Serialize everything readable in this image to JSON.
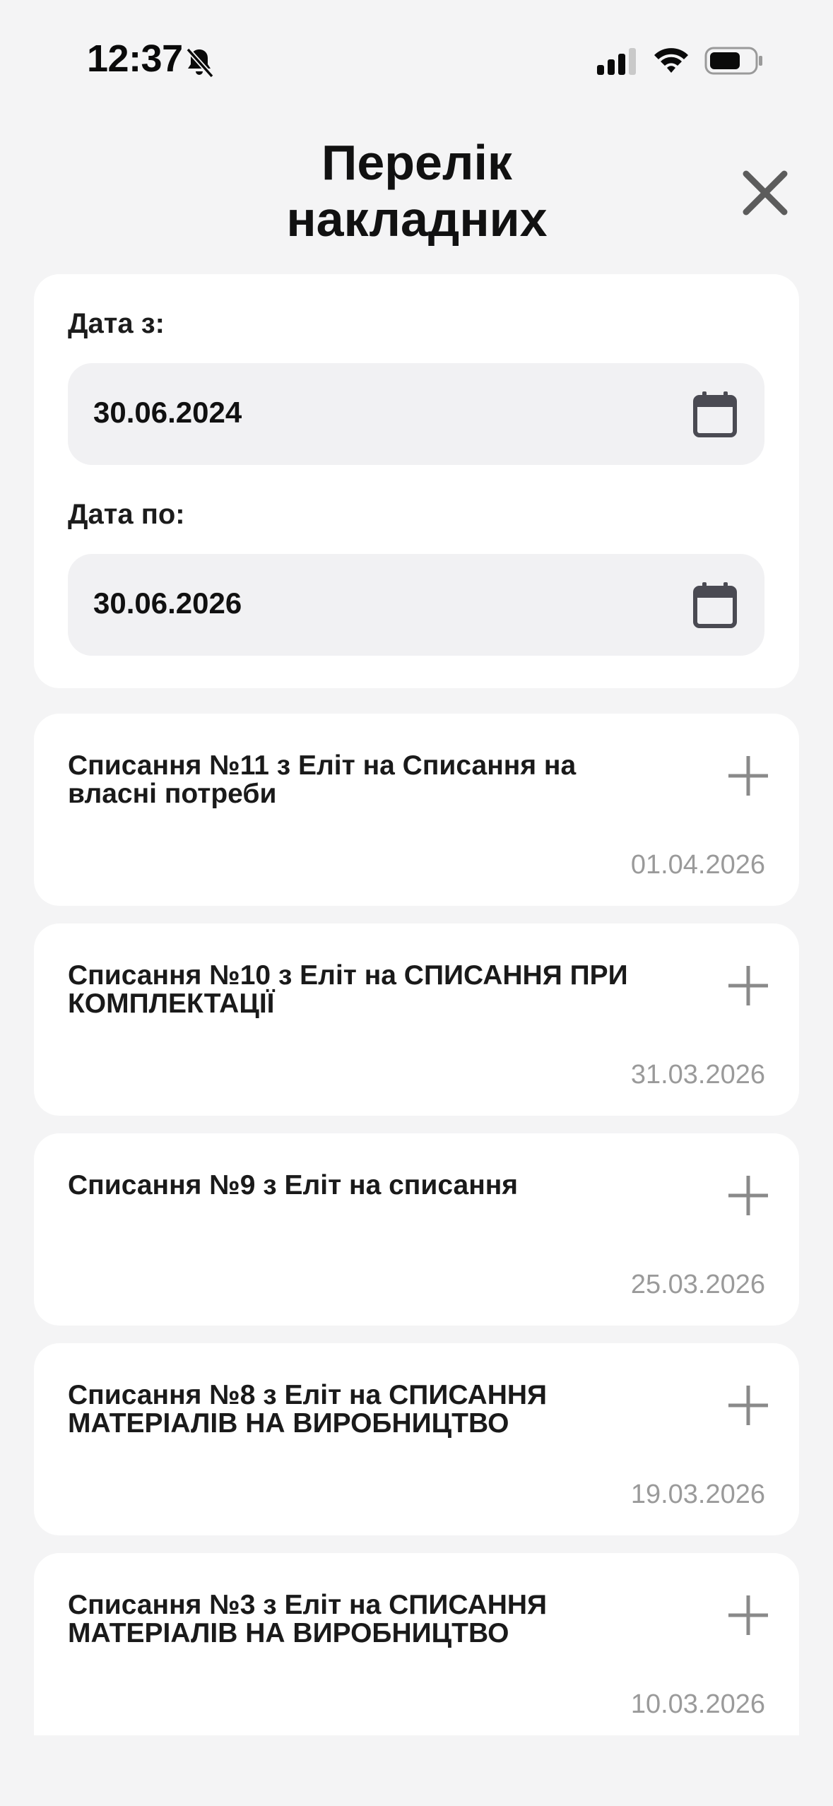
{
  "status_bar": {
    "time": "12:37",
    "icons": [
      "bell-slash-icon",
      "cellular-signal-icon",
      "wifi-icon",
      "battery-icon"
    ]
  },
  "header": {
    "title": "Перелік\nнакладних",
    "close_icon": "close-icon"
  },
  "filters": {
    "date_from": {
      "label": "Дата з:",
      "value": "30.06.2024",
      "icon": "calendar-icon"
    },
    "date_to": {
      "label": "Дата по:",
      "value": "30.06.2026",
      "icon": "calendar-icon"
    }
  },
  "invoices": [
    {
      "title": "Списання №11 з Еліт на Списання на власні потреби",
      "date": "01.04.2026"
    },
    {
      "title": "Списання №10 з Еліт на СПИСАННЯ ПРИ КОМПЛЕКТАЦІЇ",
      "date": "31.03.2026"
    },
    {
      "title": "Списання №9 з Еліт на списання",
      "date": "25.03.2026"
    },
    {
      "title": "Списання №8 з Еліт на СПИСАННЯ МАТЕРІАЛІВ НА ВИРОБНИЦТВО",
      "date": "19.03.2026"
    },
    {
      "title": "Списання №3 з Еліт на СПИСАННЯ МАТЕРІАЛІВ НА ВИРОБНИЦТВО",
      "date": "10.03.2026"
    }
  ],
  "colors": {
    "background": "#f4f4f5",
    "card": "#ffffff",
    "input_bg": "#f1f1f3",
    "muted_text": "#9a9a9a",
    "icon_gray": "#8a8a8a"
  }
}
